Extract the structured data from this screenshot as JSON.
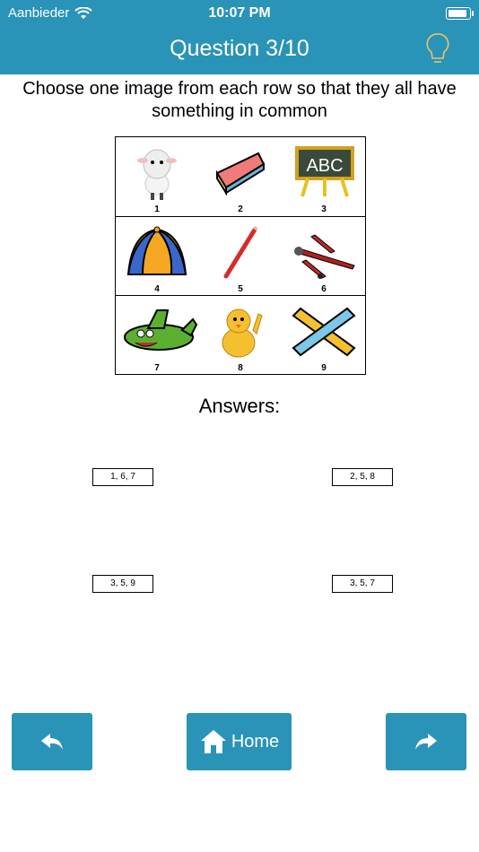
{
  "status": {
    "carrier": "Aanbieder",
    "time": "10:07 PM",
    "wifi_icon": "wifi-icon",
    "battery_icon": "battery-icon"
  },
  "header": {
    "title": "Question 3/10",
    "hint_icon": "lightbulb-icon"
  },
  "question": "Choose one image from each row so that they all have something in common",
  "grid": {
    "rows": [
      [
        {
          "num": "1",
          "icon": "lamb-icon"
        },
        {
          "num": "2",
          "icon": "cake-slice-icon"
        },
        {
          "num": "3",
          "icon": "chalkboard-icon"
        }
      ],
      [
        {
          "num": "4",
          "icon": "beanie-hat-icon"
        },
        {
          "num": "5",
          "icon": "pencil-icon"
        },
        {
          "num": "6",
          "icon": "biplane-icon"
        }
      ],
      [
        {
          "num": "7",
          "icon": "cartoon-airplane-icon"
        },
        {
          "num": "8",
          "icon": "chick-icon"
        },
        {
          "num": "9",
          "icon": "rulers-icon"
        }
      ]
    ]
  },
  "answers_label": "Answers:",
  "answers": [
    "1, 6, 7",
    "2, 5, 8",
    "3, 5, 9",
    "3, 5, 7"
  ],
  "nav": {
    "back_icon": "back-arrow-icon",
    "home_label": "Home",
    "home_icon": "home-icon",
    "forward_icon": "forward-arrow-icon"
  },
  "colors": {
    "accent": "#2a93b8",
    "hint": "#e8c56a"
  }
}
